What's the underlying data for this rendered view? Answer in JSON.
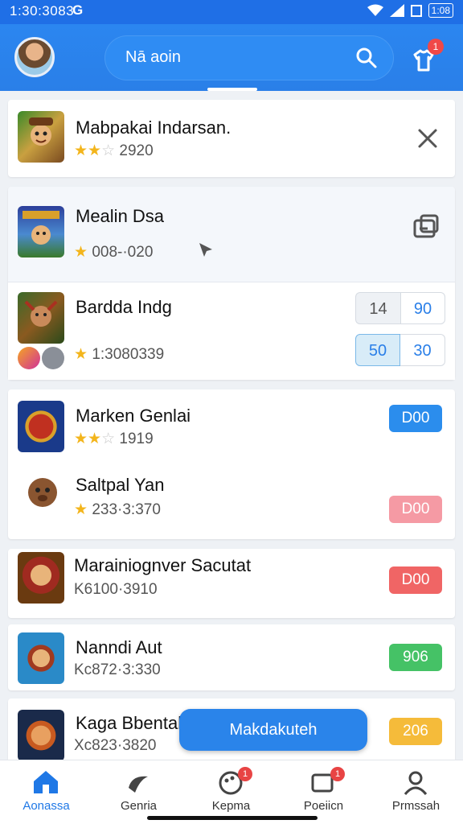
{
  "status_bar": {
    "time": "1:30:3083",
    "g_icon": "G",
    "battery": "1:08"
  },
  "header": {
    "search_text": "Nā aoin",
    "notif_badge": "1"
  },
  "items": [
    {
      "title": "Mabpakai Indarsan.",
      "meta": "2920",
      "stars": 3,
      "thumb_icon": "game-thumb-1"
    },
    {
      "title": "Mealin Dsa",
      "meta": "008-·020",
      "stars": 1
    },
    {
      "title": "Bardda Indg",
      "meta": "1:3080339",
      "stars": 1,
      "boxes": [
        "14",
        "90",
        "50",
        "30"
      ]
    },
    {
      "title": "Marken Genlai",
      "meta": "1919",
      "stars": 3,
      "button": "D00",
      "button_color": "#2b8ded"
    },
    {
      "title": "Saltpal Yan",
      "meta": "233·3:370",
      "stars": 1,
      "button": "D00",
      "button_color": "#f59aa4"
    },
    {
      "title": "Marainiognver Sacutat",
      "meta": "K6100·3910",
      "button": "D00",
      "button_color": "#f06565"
    },
    {
      "title": "Nanndi Aut",
      "meta": "Kc872·3:330",
      "button": "906",
      "button_color": "#45c266"
    },
    {
      "title": "Kaga Bbental",
      "meta": "Xc823·3820",
      "button": "206",
      "button_color": "#f5bb3a"
    }
  ],
  "fab_label": "Makdakuteh",
  "bottom_nav": [
    {
      "label": "Aonassa",
      "icon": "home-icon",
      "active": true
    },
    {
      "label": "Genria",
      "icon": "controller-icon"
    },
    {
      "label": "Kepma",
      "icon": "palette-icon",
      "badge": "1"
    },
    {
      "label": "Poeiicn",
      "icon": "message-icon",
      "badge": "1"
    },
    {
      "label": "Prmssah",
      "icon": "profile-icon"
    }
  ],
  "colors": {
    "primary": "#2a7fe8",
    "badge": "#f04848"
  }
}
